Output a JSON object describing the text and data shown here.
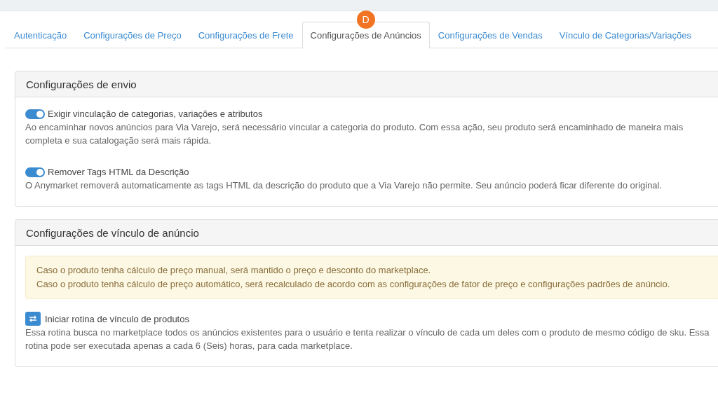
{
  "tabs": [
    {
      "label": "Autenticação",
      "selected": false
    },
    {
      "label": "Configurações de Preço",
      "selected": false
    },
    {
      "label": "Configurações de Frete",
      "selected": false
    },
    {
      "label": "Configurações de Anúncios",
      "selected": true,
      "badge": "D"
    },
    {
      "label": "Configurações de Vendas",
      "selected": false
    },
    {
      "label": "Vínculo de Categorias/Variações",
      "selected": false
    }
  ],
  "sections": [
    {
      "title": "Configurações de envio",
      "items": [
        {
          "kind": "toggle",
          "on": true,
          "label": "Exigir vinculação de categorias, variações e atributos",
          "description": "Ao encaminhar novos anúncios para Via Varejo, será necessário vincular a categoria do produto. Com essa ação, seu produto será encaminhado de maneira mais completa e sua catalogação será mais rápida."
        },
        {
          "kind": "toggle",
          "on": true,
          "label": "Remover Tags HTML da Descrição",
          "description": "O Anymarket removerá automaticamente as tags HTML da descrição do produto que a Via Varejo não permite. Seu anúncio poderá ficar diferente do original."
        }
      ]
    },
    {
      "title": "Configurações de vínculo de anúncio",
      "alert": [
        "Caso o produto tenha cálculo de preço manual, será mantido o preço e desconto do marketplace.",
        "Caso o produto tenha cálculo de preço automático, será recalculado de acordo com as configurações de fator de preço e configurações padrões de anúncio."
      ],
      "items": [
        {
          "kind": "action",
          "label": "Iniciar rotina de vínculo de produtos",
          "description": "Essa rotina busca no marketplace todos os anúncios existentes para o usuário e tenta realizar o vínculo de cada um deles com o produto de mesmo código de sku. Essa rotina pode ser executada apenas a cada 6 (Seis) horas, para cada marketplace."
        }
      ]
    }
  ]
}
